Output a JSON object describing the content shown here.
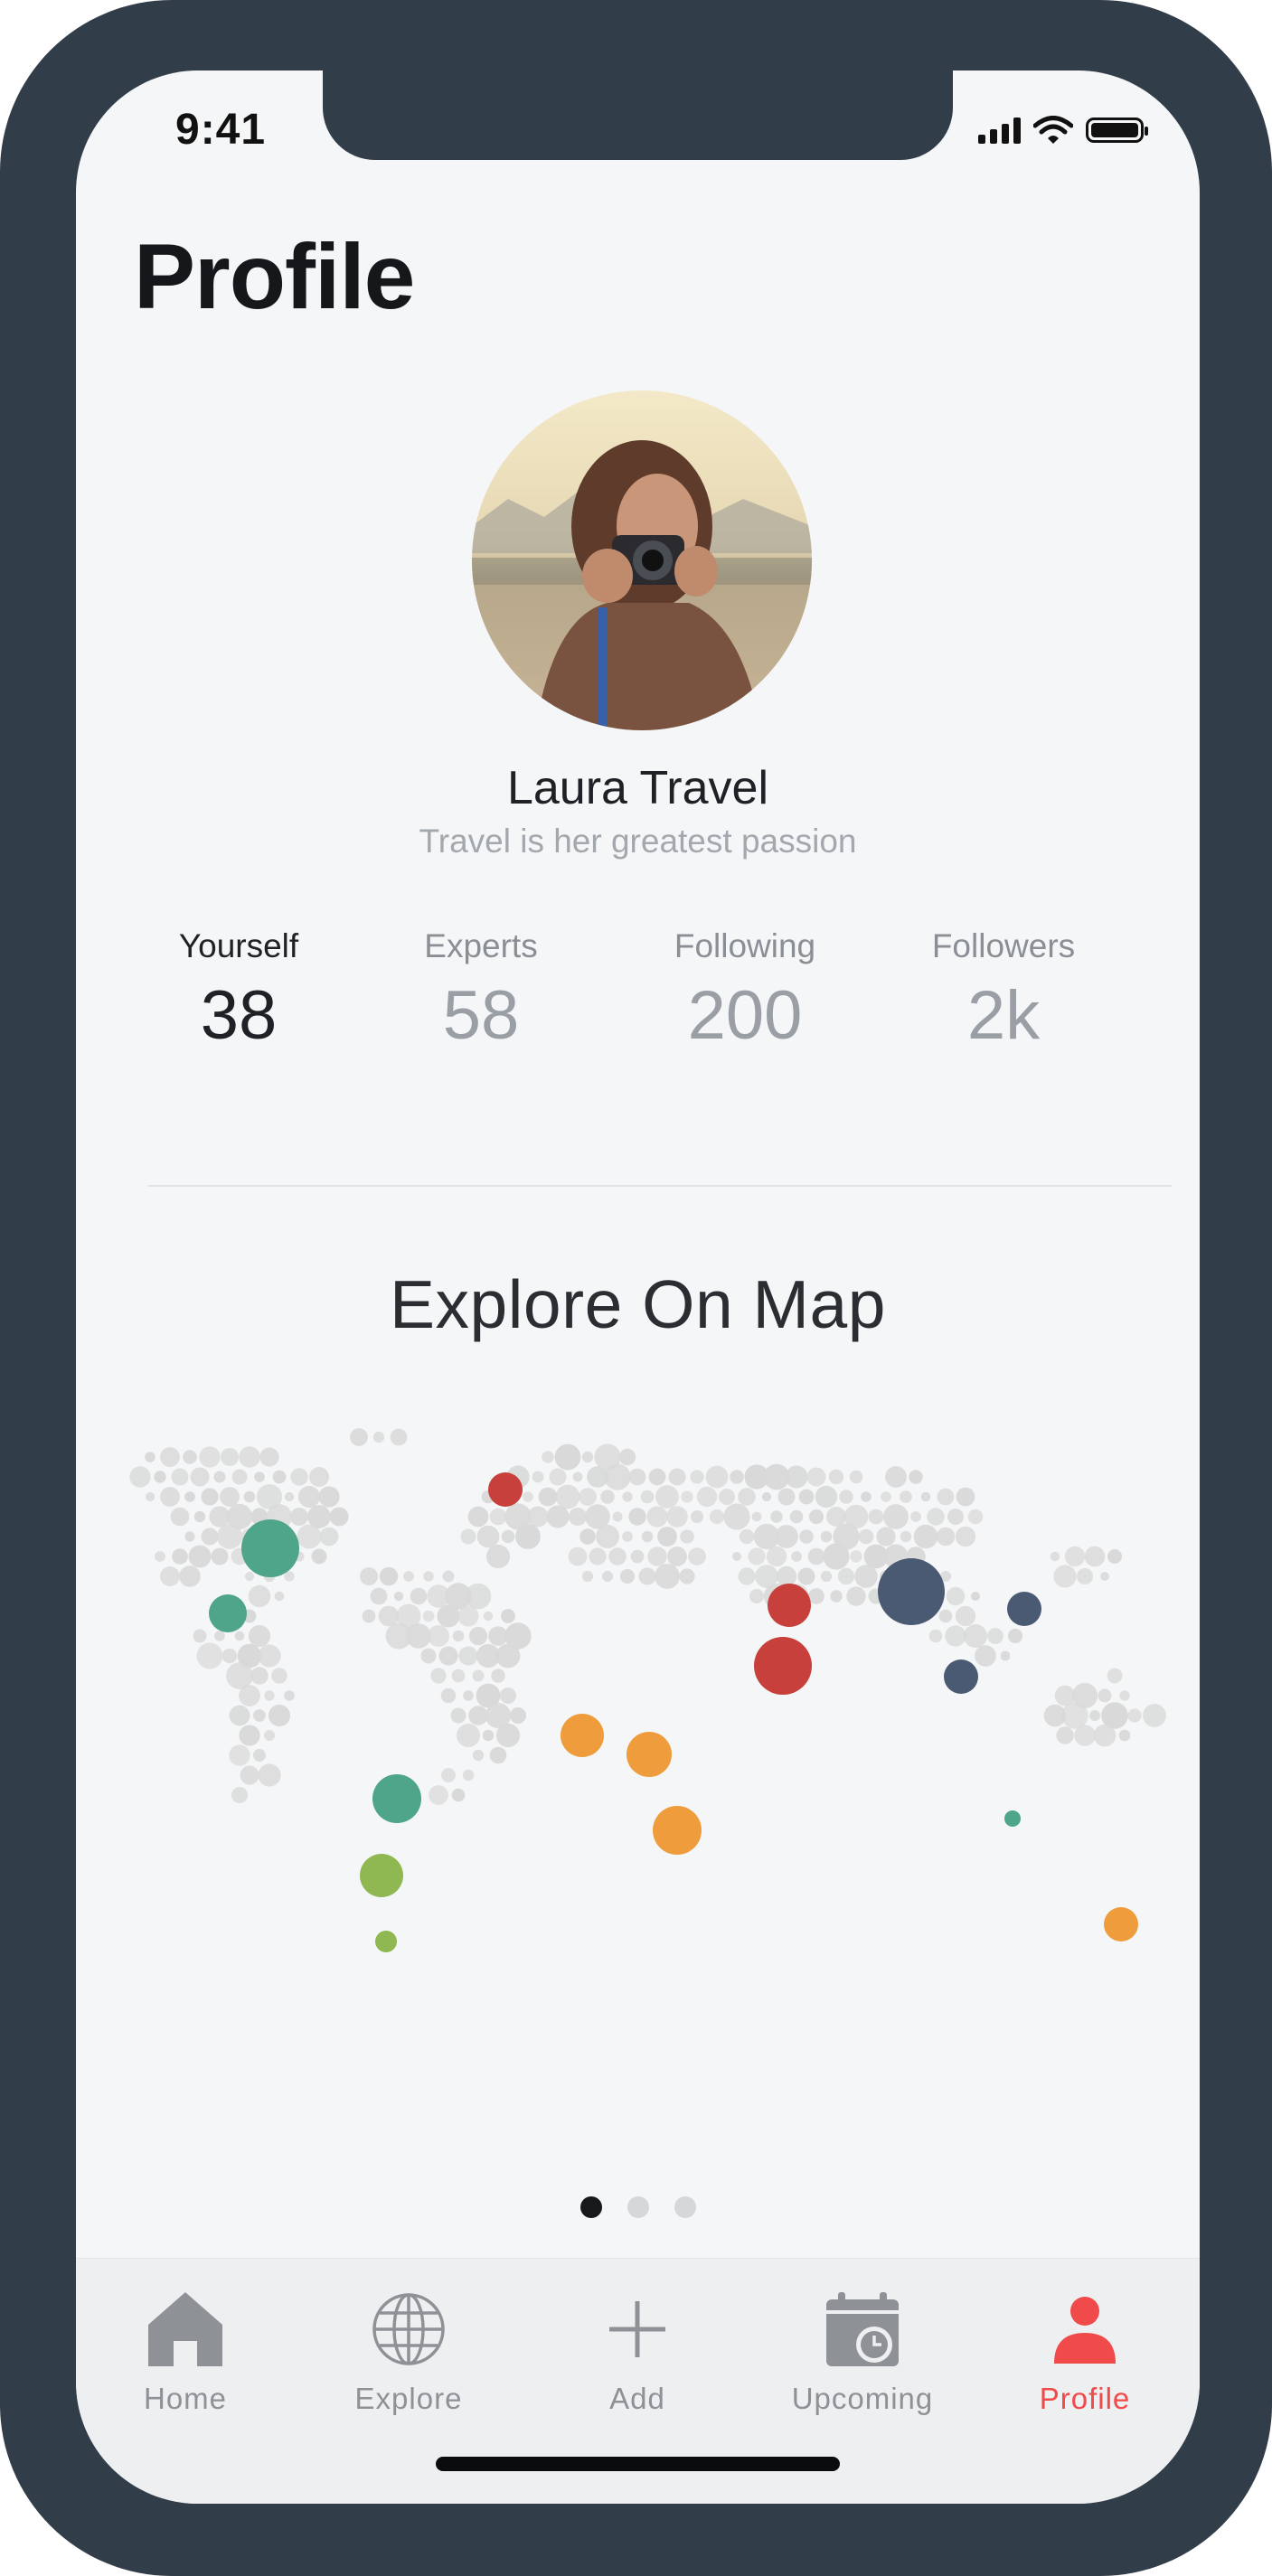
{
  "status_bar": {
    "time": "9:41"
  },
  "header": {
    "title": "Profile"
  },
  "profile": {
    "name": "Laura Travel",
    "bio": "Travel is her greatest passion"
  },
  "stats": [
    {
      "label": "Yourself",
      "value": "38"
    },
    {
      "label": "Experts",
      "value": "58"
    },
    {
      "label": "Following",
      "value": "200"
    },
    {
      "label": "Followers",
      "value": "2k"
    }
  ],
  "map_section": {
    "title": "Explore On Map",
    "colors": {
      "green": "#4fa58a",
      "red": "#c7403b",
      "navy": "#4a5a73",
      "orange": "#ee9c3c",
      "lime": "#8fb852",
      "dot": "#d9d9d9"
    }
  },
  "pager": {
    "pages": 3,
    "active": 0
  },
  "tabbar": {
    "items": [
      {
        "label": "Home",
        "icon": "home-icon"
      },
      {
        "label": "Explore",
        "icon": "globe-icon"
      },
      {
        "label": "Add",
        "icon": "plus-icon"
      },
      {
        "label": "Upcoming",
        "icon": "calendar-clock-icon"
      },
      {
        "label": "Profile",
        "icon": "person-icon"
      }
    ],
    "active_index": 4,
    "active_color": "#f04a4a",
    "inactive_color": "#8e9297"
  }
}
